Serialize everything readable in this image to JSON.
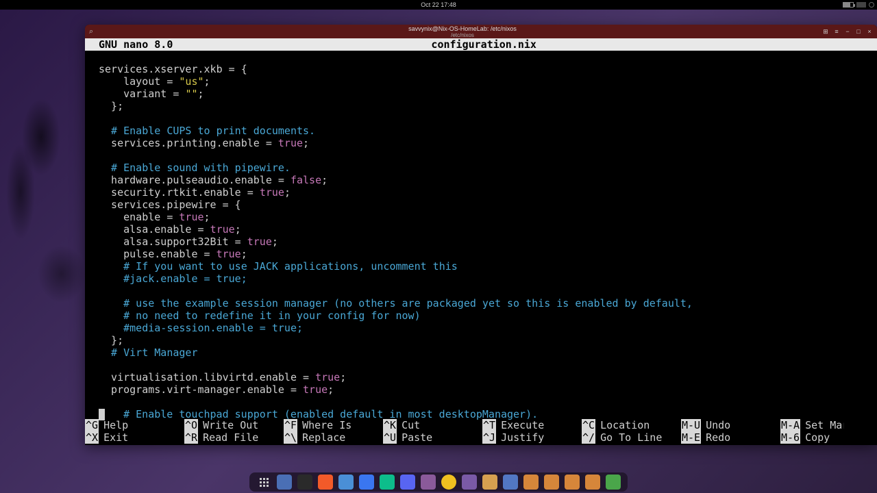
{
  "topbar": {
    "datetime": "Oct 22  17:48"
  },
  "terminal": {
    "title": "savvynix@Nix-OS-HomeLab: /etc/nixos",
    "subtitle": "/etc/nixos",
    "nano_version": "GNU nano 8.0",
    "filename": "configuration.nix"
  },
  "code": {
    "l01a": "services.xserver.xkb = {",
    "l02a": "    layout = ",
    "l02b": "\"us\"",
    "l02c": ";",
    "l03a": "    variant = ",
    "l03b": "\"\"",
    "l03c": ";",
    "l04a": "  };",
    "l06a": "  # Enable CUPS to print documents.",
    "l07a": "  services.printing.enable = ",
    "l07b": "true",
    "l07c": ";",
    "l09a": "  # Enable sound with pipewire.",
    "l10a": "  hardware.pulseaudio.enable = ",
    "l10b": "false",
    "l10c": ";",
    "l11a": "  security.rtkit.enable = ",
    "l11b": "true",
    "l11c": ";",
    "l12a": "  services.pipewire = {",
    "l13a": "    enable = ",
    "l13b": "true",
    "l13c": ";",
    "l14a": "    alsa.enable = ",
    "l14b": "true",
    "l14c": ";",
    "l15a": "    alsa.support32Bit = ",
    "l15b": "true",
    "l15c": ";",
    "l16a": "    pulse.enable = ",
    "l16b": "true",
    "l16c": ";",
    "l17a": "    # If you want to use JACK applications, uncomment this",
    "l18a": "    #jack.enable = true;",
    "l20a": "    # use the example session manager (no others are packaged yet so this is enabled by default,",
    "l21a": "    # no need to redefine it in your config for now)",
    "l22a": "    #media-session.enable = true;",
    "l23a": "  };",
    "l24a": "  # Virt Manager",
    "l26a": "  virtualisation.libvirtd.enable = ",
    "l26b": "true",
    "l26c": ";",
    "l27a": "  programs.virt-manager.enable = ",
    "l27b": "true",
    "l27c": ";",
    "l29a": "  # Enable touchpad support (enabled default in most desktopManager)."
  },
  "shortcuts": {
    "row1": [
      {
        "k": "^G",
        "l": "Help"
      },
      {
        "k": "^O",
        "l": "Write Out"
      },
      {
        "k": "^F",
        "l": "Where Is"
      },
      {
        "k": "^K",
        "l": "Cut"
      },
      {
        "k": "^T",
        "l": "Execute"
      },
      {
        "k": "^C",
        "l": "Location"
      },
      {
        "k": "M-U",
        "l": "Undo"
      },
      {
        "k": "M-A",
        "l": "Set Mar"
      }
    ],
    "row2": [
      {
        "k": "^X",
        "l": "Exit"
      },
      {
        "k": "^R",
        "l": "Read File"
      },
      {
        "k": "^\\",
        "l": "Replace"
      },
      {
        "k": "^U",
        "l": "Paste"
      },
      {
        "k": "^J",
        "l": "Justify"
      },
      {
        "k": "^/",
        "l": "Go To Line"
      },
      {
        "k": "M-E",
        "l": "Redo"
      },
      {
        "k": "M-6",
        "l": "Copy"
      }
    ]
  },
  "dock": {
    "items": [
      {
        "name": "apps",
        "bg": "transparent"
      },
      {
        "name": "calendar",
        "bg": "#4a6fb5"
      },
      {
        "name": "terminal",
        "bg": "#2a2a2a"
      },
      {
        "name": "brave",
        "bg": "#f25a29"
      },
      {
        "name": "firefox",
        "bg": "#4a8fd6"
      },
      {
        "name": "signal",
        "bg": "#3a76f0"
      },
      {
        "name": "element",
        "bg": "#0dbd8b"
      },
      {
        "name": "discord",
        "bg": "#5865f2"
      },
      {
        "name": "files",
        "bg": "#8a5a9a"
      },
      {
        "name": "brightness",
        "bg": "#f0c020",
        "round": true
      },
      {
        "name": "obsidian",
        "bg": "#7a5aa6"
      },
      {
        "name": "gopass",
        "bg": "#d6a050"
      },
      {
        "name": "nix",
        "bg": "#5277c3"
      },
      {
        "name": "ws1",
        "bg": "#d6863a"
      },
      {
        "name": "ws2",
        "bg": "#d6863a"
      },
      {
        "name": "ws3",
        "bg": "#d6863a"
      },
      {
        "name": "ws4",
        "bg": "#d6863a"
      },
      {
        "name": "trash",
        "bg": "#4aa64a"
      }
    ]
  }
}
